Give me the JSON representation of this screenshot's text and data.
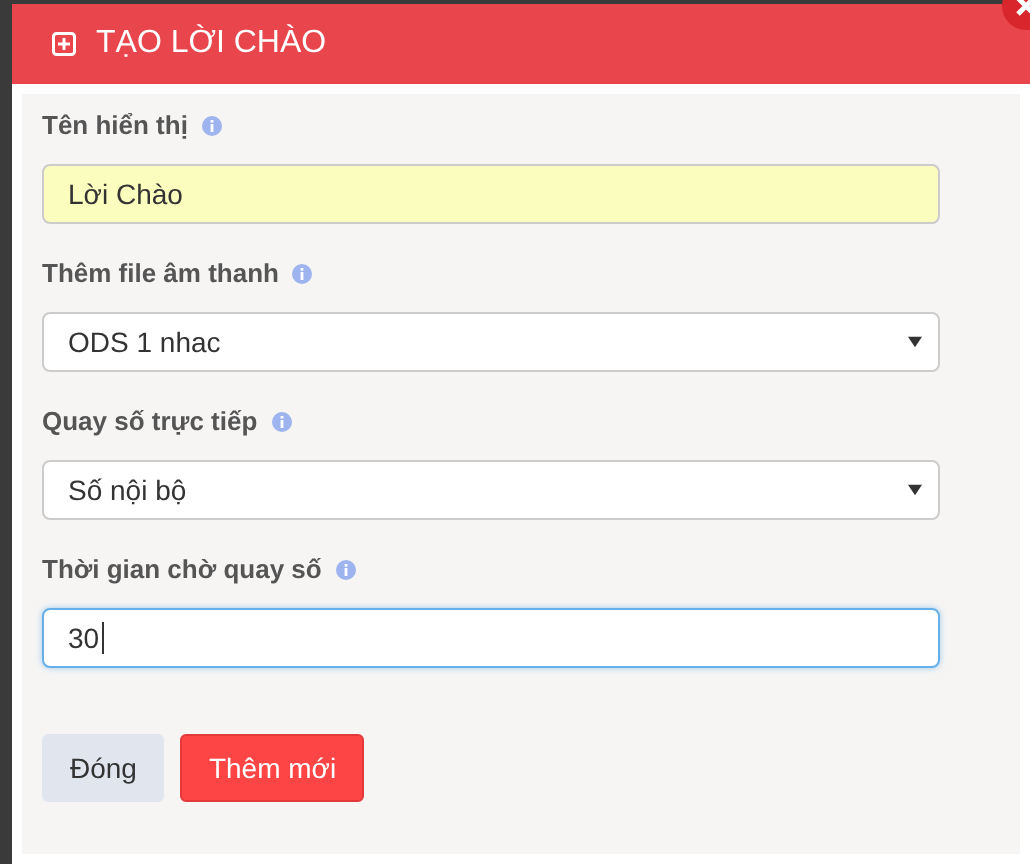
{
  "dialog": {
    "title": "TẠO LỜI CHÀO"
  },
  "fields": [
    {
      "label": "Tên hiển thị",
      "kind": "text",
      "value": "Lời Chào",
      "highlighted": true,
      "focused": false
    },
    {
      "label": "Thêm file âm thanh",
      "kind": "select",
      "value": "ODS  1  nhac",
      "highlighted": false,
      "focused": false
    },
    {
      "label": "Quay số trực tiếp",
      "kind": "select",
      "value": "Số nội bộ",
      "highlighted": false,
      "focused": false
    },
    {
      "label": "Thời gian chờ quay số",
      "kind": "text",
      "value": "30",
      "highlighted": false,
      "focused": true
    }
  ],
  "buttons": [
    {
      "label": "Đóng",
      "kind": "secondary"
    },
    {
      "label": "Thêm mới",
      "kind": "primary"
    }
  ]
}
